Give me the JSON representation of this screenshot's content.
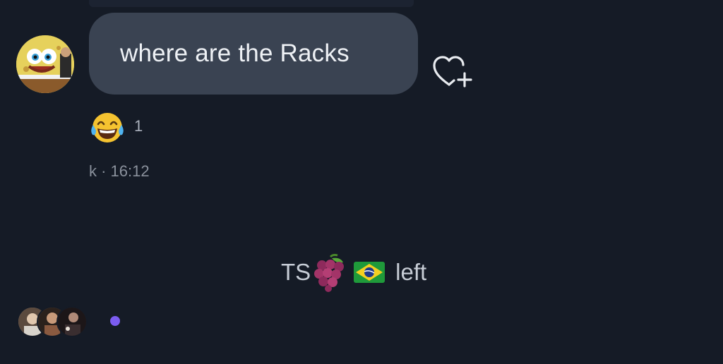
{
  "conversation": {
    "message": {
      "text": "where are the Racks",
      "sender_avatar_icon": "sponge-cartoon-avatar",
      "reaction": {
        "emoji_icon": "tears-of-joy-emoji",
        "count": "1"
      },
      "meta": "k · 16:12",
      "action_icon": "heart-plus-icon"
    },
    "system_message": {
      "prefix": "TS",
      "emoji_icons": [
        "grapes-emoji",
        "brazil-flag-emoji"
      ],
      "suffix": "left"
    },
    "seen_by": {
      "avatar_icons": [
        "participant-avatar",
        "participant-avatar",
        "participant-avatar"
      ],
      "typing_indicator_color": "#7b5cf0"
    }
  },
  "colors": {
    "background": "#151b26",
    "bubble": "#3a4352",
    "bubble_text": "#eef1f5",
    "meta_text": "#8a919c"
  }
}
